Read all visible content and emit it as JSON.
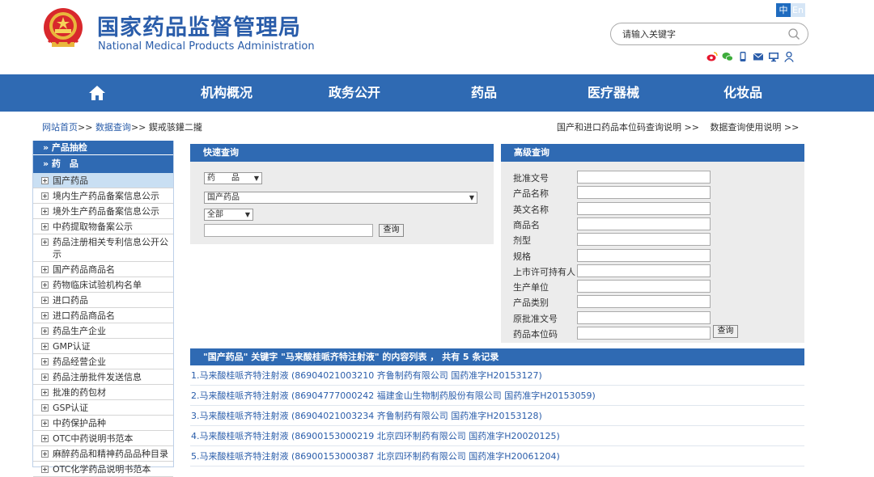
{
  "header": {
    "title_cn": "国家药品监督管理局",
    "title_en": "National Medical Products Administration",
    "lang_zh": "中",
    "lang_en": "En",
    "search_placeholder": "请输入关键字"
  },
  "social_icons": [
    "weibo-icon",
    "wechat-icon",
    "mobile-icon",
    "mail-icon",
    "monitor-icon",
    "user-icon"
  ],
  "nav": {
    "home_icon": "home-icon",
    "items": [
      "机构概况",
      "政务公开",
      "药品",
      "医疗器械",
      "化妆品"
    ]
  },
  "breadcrumb": {
    "home": "网站首页",
    "sep": ">>",
    "query": "数据查询",
    "current": "鍥戒骇鑵⼆攏"
  },
  "right_links": [
    "国产和进口药品本位码查询说明 >>",
    "数据查询使用说明 >>"
  ],
  "sidebar": {
    "section1": "» 产品抽检",
    "section2": "» 药　品",
    "items": [
      "国产药品",
      "境内生产药品备案信息公示",
      "境外生产药品备案信息公示",
      "中药提取物备案公示",
      "药品注册相关专利信息公开公示",
      "国产药品商品名",
      "药物临床试验机构名单",
      "进口药品",
      "进口药品商品名",
      "药品生产企业",
      "GMP认证",
      "药品经营企业",
      "药品注册批件发送信息",
      "批准的药包材",
      "GSP认证",
      "中药保护品种",
      "OTC中药说明书范本",
      "麻醉药品和精神药品品种目录",
      "OTC化学药品说明书范本"
    ]
  },
  "quick": {
    "title": "快速查询",
    "select1": "药　　品",
    "select2": "国产药品",
    "select3": "全部",
    "button": "查询"
  },
  "advanced": {
    "title": "高级查询",
    "fields": [
      "批准文号",
      "产品名称",
      "英文名称",
      "商品名",
      "剂型",
      "规格",
      "上市许可持有人",
      "生产单位",
      "产品类别",
      "原批准文号",
      "药品本位码"
    ],
    "button": "查询"
  },
  "results": {
    "header": "\"国产药品\" 关键字 \"马来酸桂哌齐特注射液\" 的内容列表 ， 共有 5 条记录",
    "rows": [
      "1.马来酸桂哌齐特注射液 (86904021003210 齐鲁制药有限公司 国药准字H20153127)",
      "2.马来酸桂哌齐特注射液 (86904777000242 福建金山生物制药股份有限公司 国药准字H20153059)",
      "3.马来酸桂哌齐特注射液 (86904021003234 齐鲁制药有限公司 国药准字H20153128)",
      "4.马来酸桂哌齐特注射液 (86900153000219 北京四环制药有限公司 国药准字H20020125)",
      "5.马来酸桂哌齐特注射液 (86900153000387 北京四环制药有限公司 国药准字H20061204)"
    ]
  }
}
